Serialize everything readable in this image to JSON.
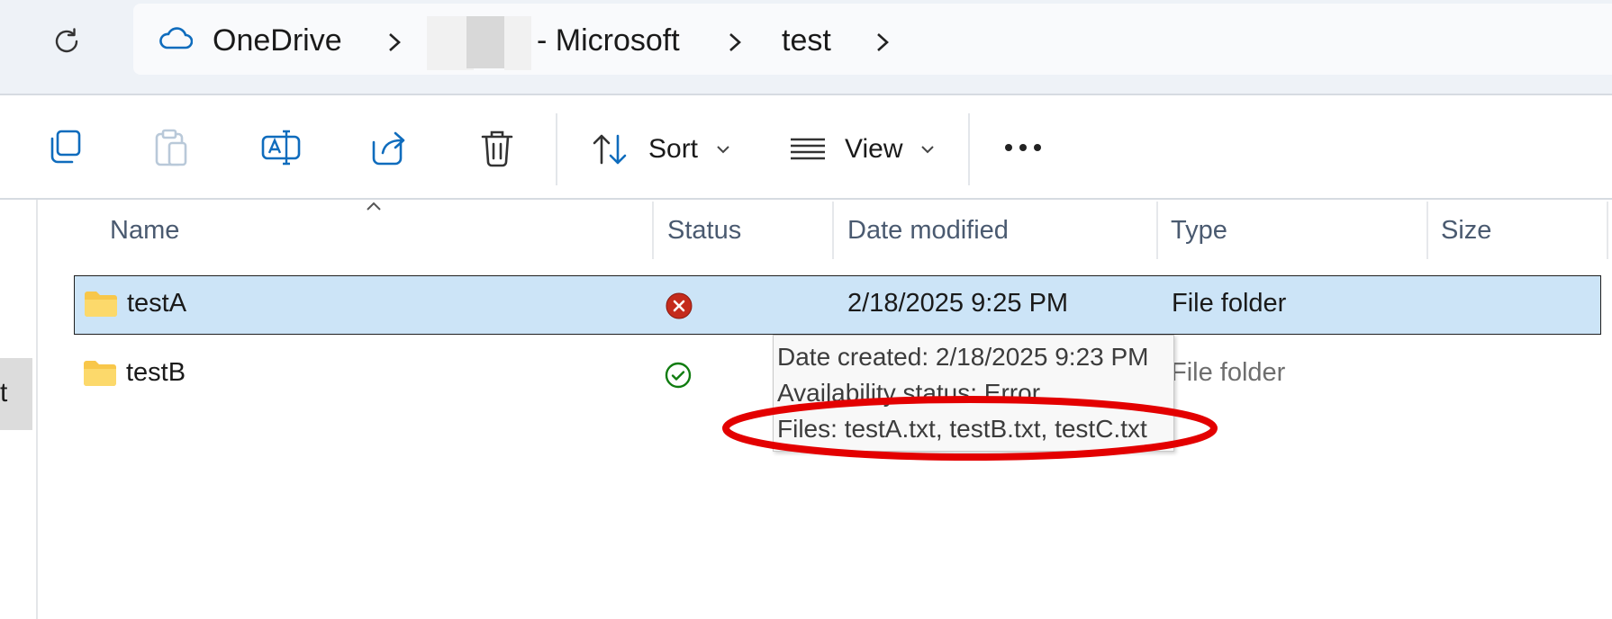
{
  "address_bar": {
    "refresh_icon": "refresh-icon",
    "crumbs": [
      {
        "label": "OneDrive",
        "icon": "cloud-icon"
      },
      {
        "label": "- Microsoft"
      },
      {
        "label": "test"
      }
    ]
  },
  "toolbar": {
    "sort_label": "Sort",
    "view_label": "View"
  },
  "left_pane": {
    "stub_text": "t"
  },
  "columns": {
    "name": "Name",
    "status": "Status",
    "date_modified": "Date modified",
    "type": "Type",
    "size": "Size"
  },
  "rows": [
    {
      "name": "testA",
      "status": "error",
      "date_modified": "2/18/2025 9:25 PM",
      "type": "File folder",
      "selected": true
    },
    {
      "name": "testB",
      "status": "synced",
      "date_modified": "",
      "type": "File folder",
      "selected": false
    }
  ],
  "tooltip": {
    "date_created": "Date created: 2/18/2025 9:23 PM",
    "availability": "Availability status: Error",
    "files": "Files: testA.txt, testB.txt, testC.txt"
  },
  "colors": {
    "selection": "#cce4f7",
    "error": "#c42b1c",
    "success": "#107c10",
    "folder": "#f8c74a",
    "annotation": "#e30000",
    "onedrive": "#0f6cbd"
  }
}
